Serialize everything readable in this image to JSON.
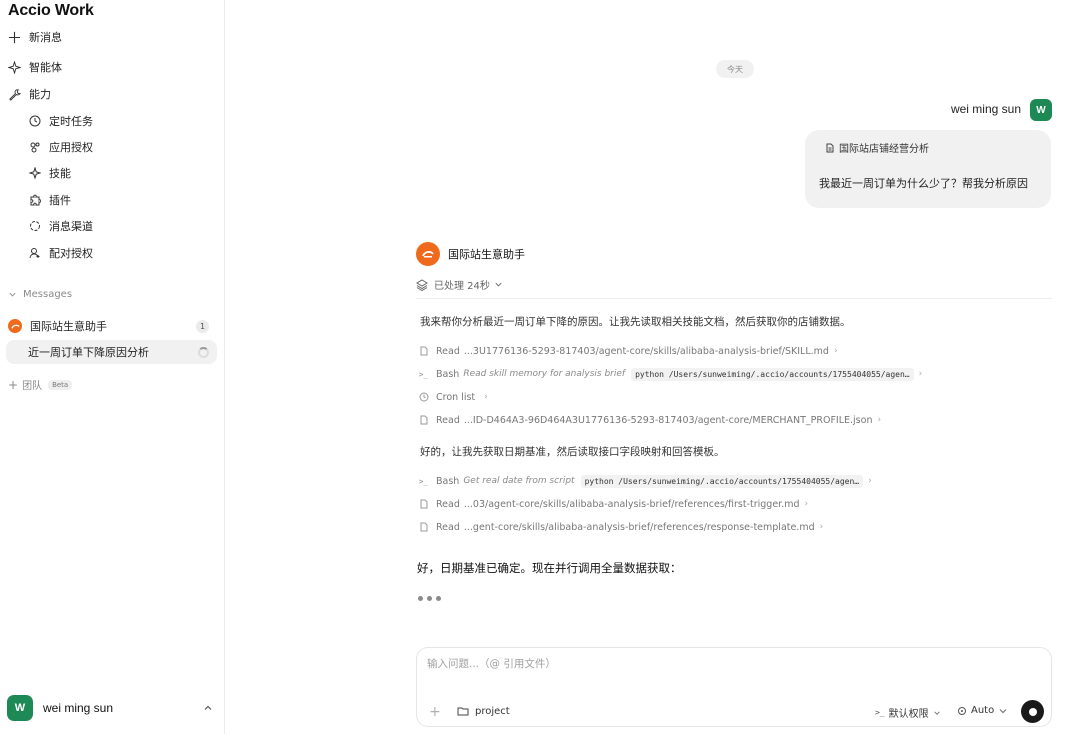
{
  "app": {
    "brand": "Accio Work"
  },
  "sidebar": {
    "nav": [
      {
        "label": "新消息",
        "icon": "plus-icon"
      },
      {
        "label": "智能体",
        "icon": "sparkle-icon"
      },
      {
        "label": "能力",
        "icon": "wrench-icon"
      }
    ],
    "sub_items": [
      {
        "label": "定时任务",
        "icon": "clock-icon"
      },
      {
        "label": "应用授权",
        "icon": "apps-icon"
      },
      {
        "label": "技能",
        "icon": "sparkle-icon"
      },
      {
        "label": "插件",
        "icon": "puzzle-icon"
      },
      {
        "label": "消息渠道",
        "icon": "channel-icon"
      },
      {
        "label": "配对授权",
        "icon": "user-key-icon"
      }
    ],
    "messages_title": "Messages",
    "conversations": [
      {
        "label": "国际站生意助手",
        "badge": "1"
      },
      {
        "label": "近一周订单下降原因分析",
        "status": "loading"
      }
    ],
    "team_label": "团队",
    "beta_label": "Beta",
    "user": {
      "initial": "W",
      "name": "wei ming sun"
    }
  },
  "chat": {
    "date_label": "今天",
    "user": {
      "name": "wei ming sun",
      "initial": "W"
    },
    "user_message": {
      "reference": "国际站店铺经营分析",
      "text": "我最近一周订单为什么少了？帮我分析原因"
    },
    "agent": {
      "name": "国际站生意助手",
      "processed": "已处理 24秒",
      "intro": "我来帮你分析最近一周订单下降的原因。让我先读取相关技能文档，然后获取你的店铺数据。",
      "tools_1": [
        {
          "icon": "file-icon",
          "name": "Read",
          "path": "...3U1776136-5293-817403/agent-core/skills/alibaba-analysis-brief/SKILL.md"
        },
        {
          "icon": "terminal-icon",
          "name": "Bash",
          "desc": "Read skill memory for analysis brief",
          "code": "python /Users/sunweiming/.accio/accounts/1755404055/agen…"
        },
        {
          "icon": "clock-icon",
          "name": "Cron list"
        },
        {
          "icon": "file-icon",
          "name": "Read",
          "path": "...ID-D464A3-96D464A3U1776136-5293-817403/agent-core/MERCHANT_PROFILE.json"
        }
      ],
      "middle": "好的，让我先获取日期基准，然后读取接口字段映射和回答模板。",
      "tools_2": [
        {
          "icon": "terminal-icon",
          "name": "Bash",
          "desc": "Get real date from script",
          "code": "python /Users/sunweiming/.accio/accounts/1755404055/agen…"
        },
        {
          "icon": "file-icon",
          "name": "Read",
          "path": "...03/agent-core/skills/alibaba-analysis-brief/references/first-trigger.md"
        },
        {
          "icon": "file-icon",
          "name": "Read",
          "path": "...gent-core/skills/alibaba-analysis-brief/references/response-template.md"
        }
      ],
      "final": "好，日期基准已确定。现在并行调用全量数据获取："
    }
  },
  "composer": {
    "placeholder": "输入问题...（@ 引用文件）",
    "value": "",
    "project_label": "project",
    "permission_label": "默认权限",
    "mode_label": "Auto"
  },
  "colors": {
    "brand_green": "#1d8a55",
    "agent_orange": "#f06a1d"
  }
}
